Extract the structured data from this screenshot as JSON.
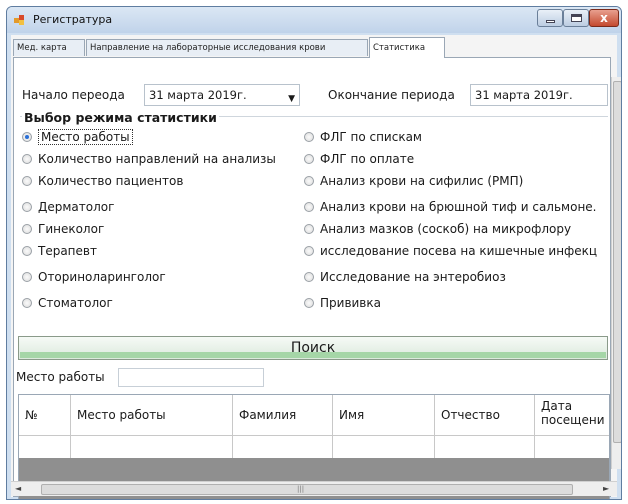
{
  "window": {
    "title": "Регистратура",
    "close_glyph": "x"
  },
  "tabs": [
    {
      "label": "Мед. карта"
    },
    {
      "label": "Направление на лабораторные исследования крови"
    },
    {
      "label": "Статистика"
    }
  ],
  "period": {
    "start_label": "Начало переода",
    "start_value": "31   марта   2019г.",
    "end_label": "Окончание периода",
    "end_value": "31   марта   2019г."
  },
  "mode_group": {
    "title": "Выбор режима статистики",
    "left_options": [
      {
        "label": "Место работы",
        "selected": true
      },
      {
        "label": "Количество направлений на анализы",
        "selected": false
      },
      {
        "label": "Количество пациентов",
        "selected": false
      },
      {
        "label": "Дерматолог",
        "selected": false
      },
      {
        "label": "Гинеколог",
        "selected": false
      },
      {
        "label": "Терапевт",
        "selected": false
      },
      {
        "label": "Оториноларинголог",
        "selected": false
      },
      {
        "label": "Стоматолог",
        "selected": false
      }
    ],
    "right_options": [
      {
        "label": "ФЛГ по спискам",
        "selected": false
      },
      {
        "label": "ФЛГ по оплате",
        "selected": false
      },
      {
        "label": "Анализ крови на сифилис (РМП)",
        "selected": false
      },
      {
        "label": "Анализ крови на брюшной тиф и сальмоне.",
        "selected": false
      },
      {
        "label": "Анализ  мазков (соскоб) на микрофлору",
        "selected": false
      },
      {
        "label": "исследование посева на кишечные инфекц",
        "selected": false
      },
      {
        "label": "Исследование на энтеробиоз",
        "selected": false
      },
      {
        "label": "Прививка",
        "selected": false
      }
    ]
  },
  "search": {
    "button_label": "Поиск"
  },
  "filter": {
    "label": "Место работы",
    "value": ""
  },
  "table": {
    "columns": [
      "№",
      "Место работы",
      "Фамилия",
      "Имя",
      "Отчество",
      "Дата посещени"
    ]
  },
  "colors": {
    "accent": "#2a6fd6",
    "progress": "#a5d6a7",
    "empty_grid": "#8f8f8f"
  }
}
